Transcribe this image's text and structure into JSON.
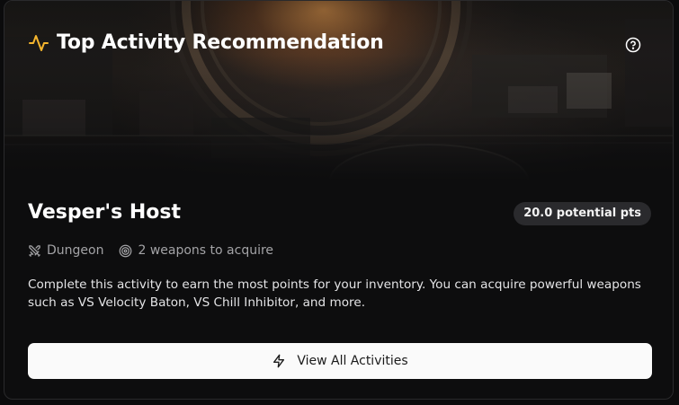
{
  "header": {
    "title": "Top Activity Recommendation",
    "title_icon": "activity-pulse-icon",
    "help_icon": "help-circle-icon",
    "accent_color": "#f5b52e"
  },
  "activity": {
    "name": "Vesper's Host",
    "points_badge": "20.0 potential pts",
    "type_icon": "crossed-swords-icon",
    "type_label": "Dungeon",
    "weapons_icon": "target-icon",
    "weapons_label": "2 weapons to acquire",
    "description": "Complete this activity to earn the most points for your inventory. You can acquire powerful weapons such as VS Velocity Baton, VS Chill Inhibitor, and more."
  },
  "actions": {
    "view_all_label": "View All Activities",
    "view_all_icon": "lightning-bolt-icon"
  }
}
